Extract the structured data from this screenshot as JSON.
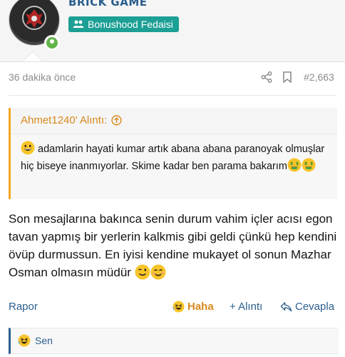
{
  "author": {
    "username": "BRICK GAME",
    "rank_badge": "Bonushood Fedaisi",
    "online": true
  },
  "post": {
    "time": "36 dakika önce",
    "post_number": "#2,663",
    "share_icon": "share-icon",
    "bookmark_icon": "bookmark-icon"
  },
  "quote": {
    "author_label": "Ahmet1240' Alıntı:",
    "text": "adamlarin hayati kumar artık abana abana paranoyak olmuşlar hiç biseye inanmıyorlar. Skime kadar ben parama bakarım"
  },
  "message": {
    "text": "Son mesajlarına bakınca senin durum vahim içler acısı egon tavan yapmış bir yerlerin kalkmis gibi geldi çünkü hep kendini övüp durmussun. En iyisi kendine mukayet ol sonun Mazhar Osman olmasın müdür"
  },
  "actions": {
    "report": "Rapor",
    "haha": "Haha",
    "quote": "+ Alıntı",
    "reply": "Cevapla"
  },
  "reactions": {
    "text": "Sen"
  },
  "colors": {
    "accent": "#2a5e8d",
    "badge": "#1c9f95",
    "quote_accent": "#f5a623",
    "online": "#63b54a"
  }
}
